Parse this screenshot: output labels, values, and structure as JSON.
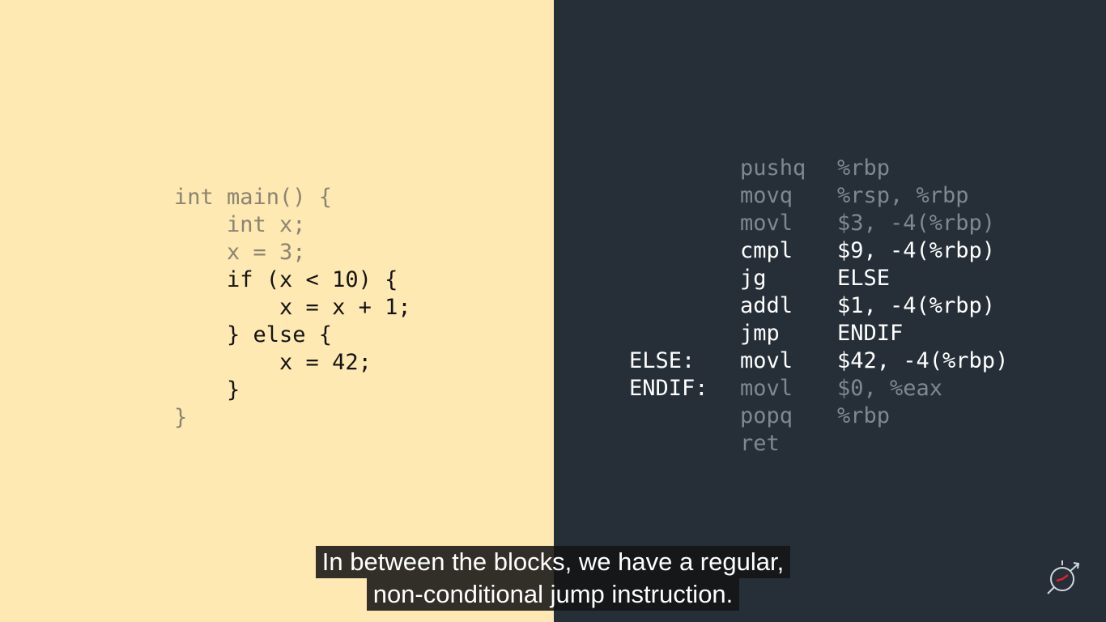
{
  "c_code": {
    "lines": [
      {
        "text": "int main() {",
        "style": "dim"
      },
      {
        "text": "    int x;",
        "style": "dim"
      },
      {
        "text": "    x = 3;",
        "style": "dim"
      },
      {
        "text": "    if (x < 10) {",
        "style": "bright"
      },
      {
        "text": "        x = x + 1;",
        "style": "bright"
      },
      {
        "text": "    } else {",
        "style": "bright"
      },
      {
        "text": "        x = 42;",
        "style": "bright"
      },
      {
        "text": "    }",
        "style": "bright"
      },
      {
        "text": "}",
        "style": "dim"
      }
    ]
  },
  "assembly": {
    "rows": [
      {
        "label": "",
        "op": "pushq",
        "args": "%rbp",
        "style": "dim"
      },
      {
        "label": "",
        "op": "movq",
        "args": "%rsp, %rbp",
        "style": "dim"
      },
      {
        "label": "",
        "op": "movl",
        "args": "$3, -4(%rbp)",
        "style": "dim"
      },
      {
        "label": "",
        "op": "cmpl",
        "args": "$9, -4(%rbp)",
        "style": "bright"
      },
      {
        "label": "",
        "op": "jg",
        "args": "ELSE",
        "style": "bright"
      },
      {
        "label": "",
        "op": "addl",
        "args": "$1, -4(%rbp)",
        "style": "bright"
      },
      {
        "label": "",
        "op": "jmp",
        "args": "ENDIF",
        "style": "bright"
      },
      {
        "label": "ELSE:",
        "op": "movl",
        "args": "$42, -4(%rbp)",
        "style": "bright"
      },
      {
        "label": "ENDIF:",
        "op": "movl",
        "args": "$0, %eax",
        "style": "dim"
      },
      {
        "label": "",
        "op": "popq",
        "args": "%rbp",
        "style": "dim"
      },
      {
        "label": "",
        "op": "ret",
        "args": "",
        "style": "dim"
      }
    ]
  },
  "subtitles": {
    "line1": "In between the blocks, we have a regular,",
    "line2": "non-conditional jump instruction."
  },
  "colors": {
    "left_background": "#fee9b2",
    "right_background": "#262f38",
    "accent_logo": "#e0202a"
  },
  "icons": {
    "logo": "compass-logo-icon"
  }
}
